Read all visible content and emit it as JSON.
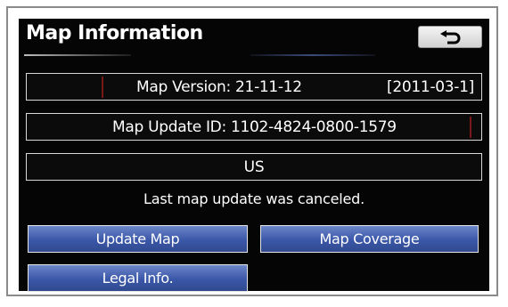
{
  "header": {
    "title": "Map Information",
    "back_icon": "return-arrow-icon"
  },
  "info": {
    "map_version_label": "Map Version:",
    "map_version_value": "21-11-12",
    "map_version_date": "[2011-03-1]",
    "update_id_label": "Map Update ID:",
    "update_id_value": "1102-4824-0800-1579",
    "region": "US"
  },
  "status": {
    "message": "Last map update was canceled."
  },
  "buttons": {
    "update_map": "Update Map",
    "map_coverage": "Map Coverage",
    "legal_info": "Legal Info."
  },
  "colors": {
    "screen_bg": "#050505",
    "button_blue": "#3a57a8",
    "text": "#ffffff"
  }
}
